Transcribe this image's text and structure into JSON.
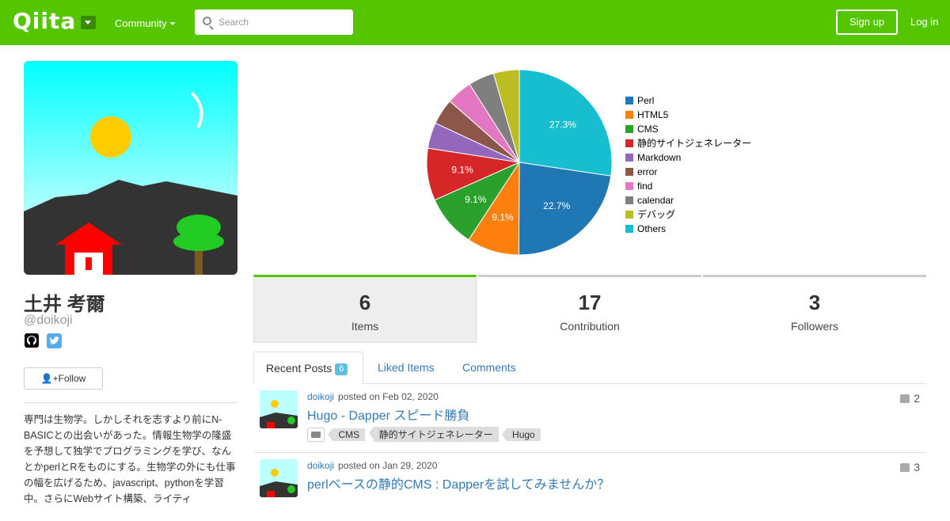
{
  "header": {
    "logo": "Qiita",
    "community_label": "Community",
    "search_placeholder": "Search",
    "signup_label": "Sign up",
    "login_label": "Log in"
  },
  "profile": {
    "name": "土井 考爾",
    "handle": "@doikoji",
    "follow_label": "Follow",
    "bio": "専門は生物学。しかしそれを志すより前にN-BASICとの出会いがあった。情報生物学の隆盛を予想して独学でプログラミングを学び、なんとかperlとRをものにする。生物学の外にも仕事の幅を広げるため、javascript、pythonを学習中。さらにWebサイト構築、ライティ"
  },
  "chart_data": {
    "type": "pie",
    "title": "",
    "slices": [
      {
        "label": "Perl",
        "value": 22.7,
        "color": "#1f77b4",
        "display": "22.7%"
      },
      {
        "label": "HTML5",
        "value": 9.1,
        "color": "#ff7f0e",
        "display": "9.1%"
      },
      {
        "label": "CMS",
        "value": 9.1,
        "color": "#2ca02c",
        "display": "9.1%"
      },
      {
        "label": "静的サイトジェネレーター",
        "value": 9.1,
        "color": "#d62728",
        "display": "9.1%"
      },
      {
        "label": "Markdown",
        "value": 4.5,
        "color": "#9467bd",
        "display": ""
      },
      {
        "label": "error",
        "value": 4.5,
        "color": "#8c564b",
        "display": ""
      },
      {
        "label": "find",
        "value": 4.5,
        "color": "#e377c2",
        "display": ""
      },
      {
        "label": "calendar",
        "value": 4.5,
        "color": "#7f7f7f",
        "display": ""
      },
      {
        "label": "デバッグ",
        "value": 4.5,
        "color": "#bcbd22",
        "display": ""
      },
      {
        "label": "Others",
        "value": 27.3,
        "color": "#17becf",
        "display": "27.3%"
      }
    ],
    "legend_position": "right"
  },
  "stats": [
    {
      "value": "6",
      "label": "Items"
    },
    {
      "value": "17",
      "label": "Contribution"
    },
    {
      "value": "3",
      "label": "Followers"
    }
  ],
  "tabs": [
    {
      "label": "Recent Posts",
      "badge": "6"
    },
    {
      "label": "Liked Items"
    },
    {
      "label": "Comments"
    }
  ],
  "posts": [
    {
      "author": "doikoji",
      "date_text": "posted on Feb 02, 2020",
      "title": "Hugo - Dapper スピード勝負",
      "tags": [
        "CMS",
        "静的サイトジェネレーター",
        "Hugo"
      ],
      "likes": "2"
    },
    {
      "author": "doikoji",
      "date_text": "posted on Jan 29, 2020",
      "title": "perlベースの静的CMS : Dapperを試してみませんか？",
      "tags": [],
      "likes": "3"
    }
  ],
  "colors": {
    "brand": "#55c500",
    "link": "#337ab7"
  }
}
